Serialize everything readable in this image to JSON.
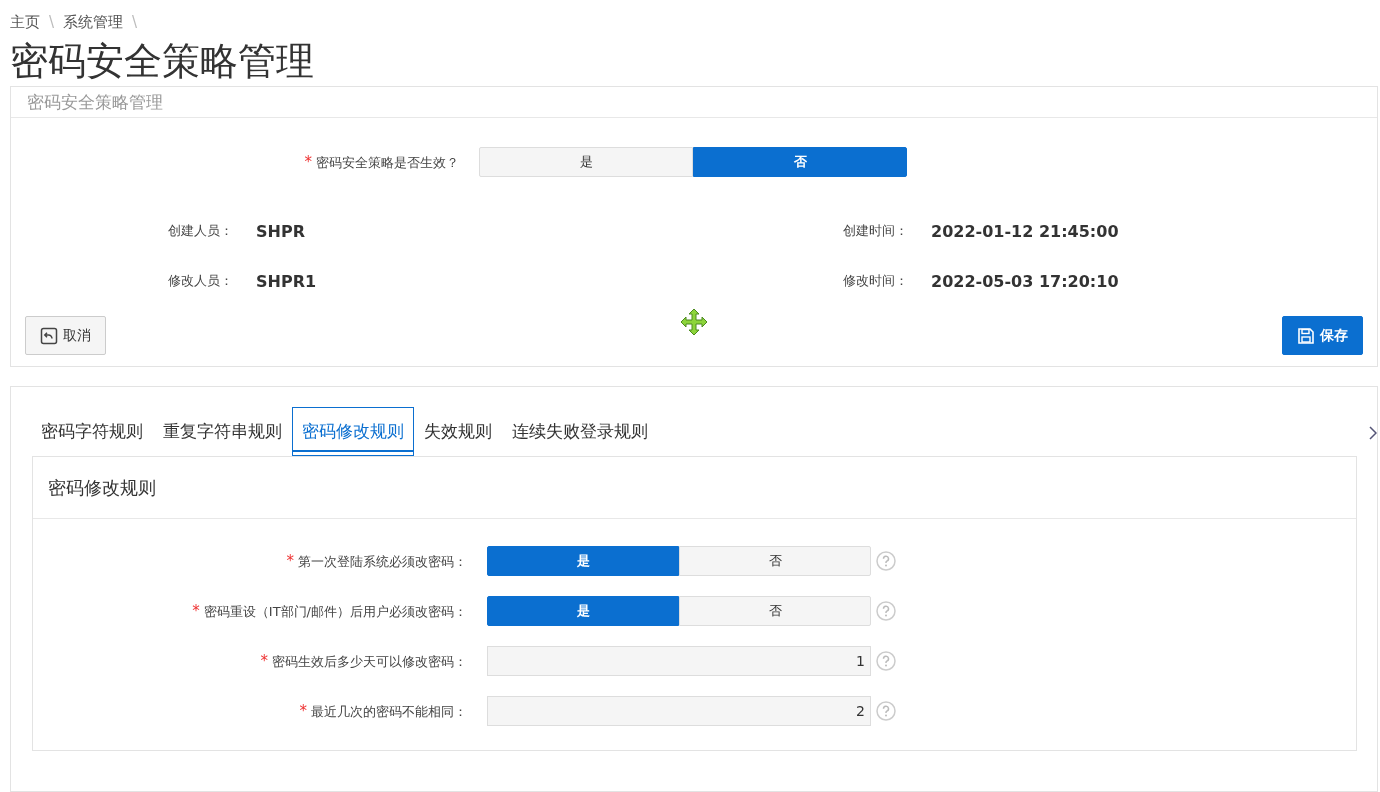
{
  "breadcrumb": [
    {
      "label": "主页"
    },
    {
      "label": "系统管理"
    }
  ],
  "breadcrumb_separator": "\\",
  "page_title": "密码安全策略管理",
  "required_marker": "*",
  "policy_panel": {
    "header": "密码安全策略管理",
    "enabled_field": {
      "label": "密码安全策略是否生效？",
      "required": true,
      "options": [
        {
          "label": "是",
          "selected": false
        },
        {
          "label": "否",
          "selected": true
        }
      ]
    },
    "info": [
      {
        "label": "创建人员：",
        "value": "SHPR"
      },
      {
        "label": "创建时间：",
        "value": "2022-01-12 21:45:00"
      },
      {
        "label": "修改人员：",
        "value": "SHPR1"
      },
      {
        "label": "修改时间：",
        "value": "2022-05-03 17:20:10"
      }
    ],
    "cancel_button": "取消",
    "save_button": "保存"
  },
  "tabs": [
    {
      "label": "密码字符规则",
      "selected": false
    },
    {
      "label": "重复字符串规则",
      "selected": false
    },
    {
      "label": "密码修改规则",
      "selected": true
    },
    {
      "label": "失效规则",
      "selected": false
    },
    {
      "label": "连续失败登录规则",
      "selected": false
    }
  ],
  "rules_card": {
    "title": "密码修改规则",
    "fields": [
      {
        "kind": "toggle",
        "label": "第一次登陆系统必须改密码：",
        "required": true,
        "options": [
          {
            "label": "是",
            "selected": true
          },
          {
            "label": "否",
            "selected": false
          }
        ]
      },
      {
        "kind": "toggle",
        "label": "密码重设（IT部门/邮件）后用户必须改密码：",
        "required": true,
        "options": [
          {
            "label": "是",
            "selected": true
          },
          {
            "label": "否",
            "selected": false
          }
        ]
      },
      {
        "kind": "number",
        "label": "密码生效后多少天可以修改密码：",
        "required": true,
        "value": "1"
      },
      {
        "kind": "number",
        "label": "最近几次的密码不能相同：",
        "required": true,
        "value": "2"
      }
    ]
  }
}
